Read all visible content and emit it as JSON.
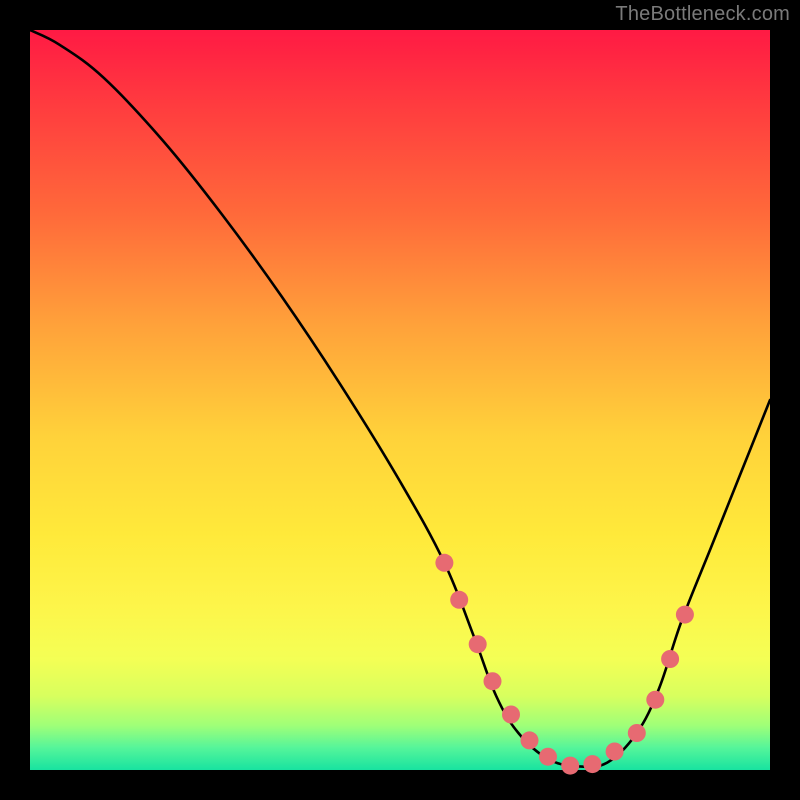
{
  "attribution": "TheBottleneck.com",
  "colors": {
    "page_bg": "#000000",
    "curve": "#000000",
    "dot": "#e76a72",
    "gradient_top": "#ff1a44",
    "gradient_bottom": "#18e3a0"
  },
  "chart_data": {
    "type": "line",
    "title": "",
    "xlabel": "",
    "ylabel": "",
    "xlim": [
      0,
      100
    ],
    "ylim": [
      0,
      100
    ],
    "grid": false,
    "series": [
      {
        "name": "bottleneck-curve",
        "x": [
          0,
          4,
          10,
          18,
          26,
          34,
          42,
          50,
          56,
          60,
          63,
          66,
          70,
          74,
          78,
          82,
          85,
          88,
          92,
          96,
          100
        ],
        "y": [
          100,
          98,
          93.5,
          85,
          75,
          64,
          52,
          39,
          28,
          18,
          10,
          5,
          1.5,
          0.5,
          1,
          5,
          11,
          20,
          30,
          40,
          50
        ]
      }
    ],
    "markers": {
      "name": "highlight-dots",
      "x": [
        56,
        58,
        60.5,
        62.5,
        65,
        67.5,
        70,
        73,
        76,
        79,
        82,
        84.5,
        86.5,
        88.5
      ],
      "y": [
        28,
        23,
        17,
        12,
        7.5,
        4,
        1.8,
        0.6,
        0.8,
        2.5,
        5,
        9.5,
        15,
        21
      ]
    }
  }
}
